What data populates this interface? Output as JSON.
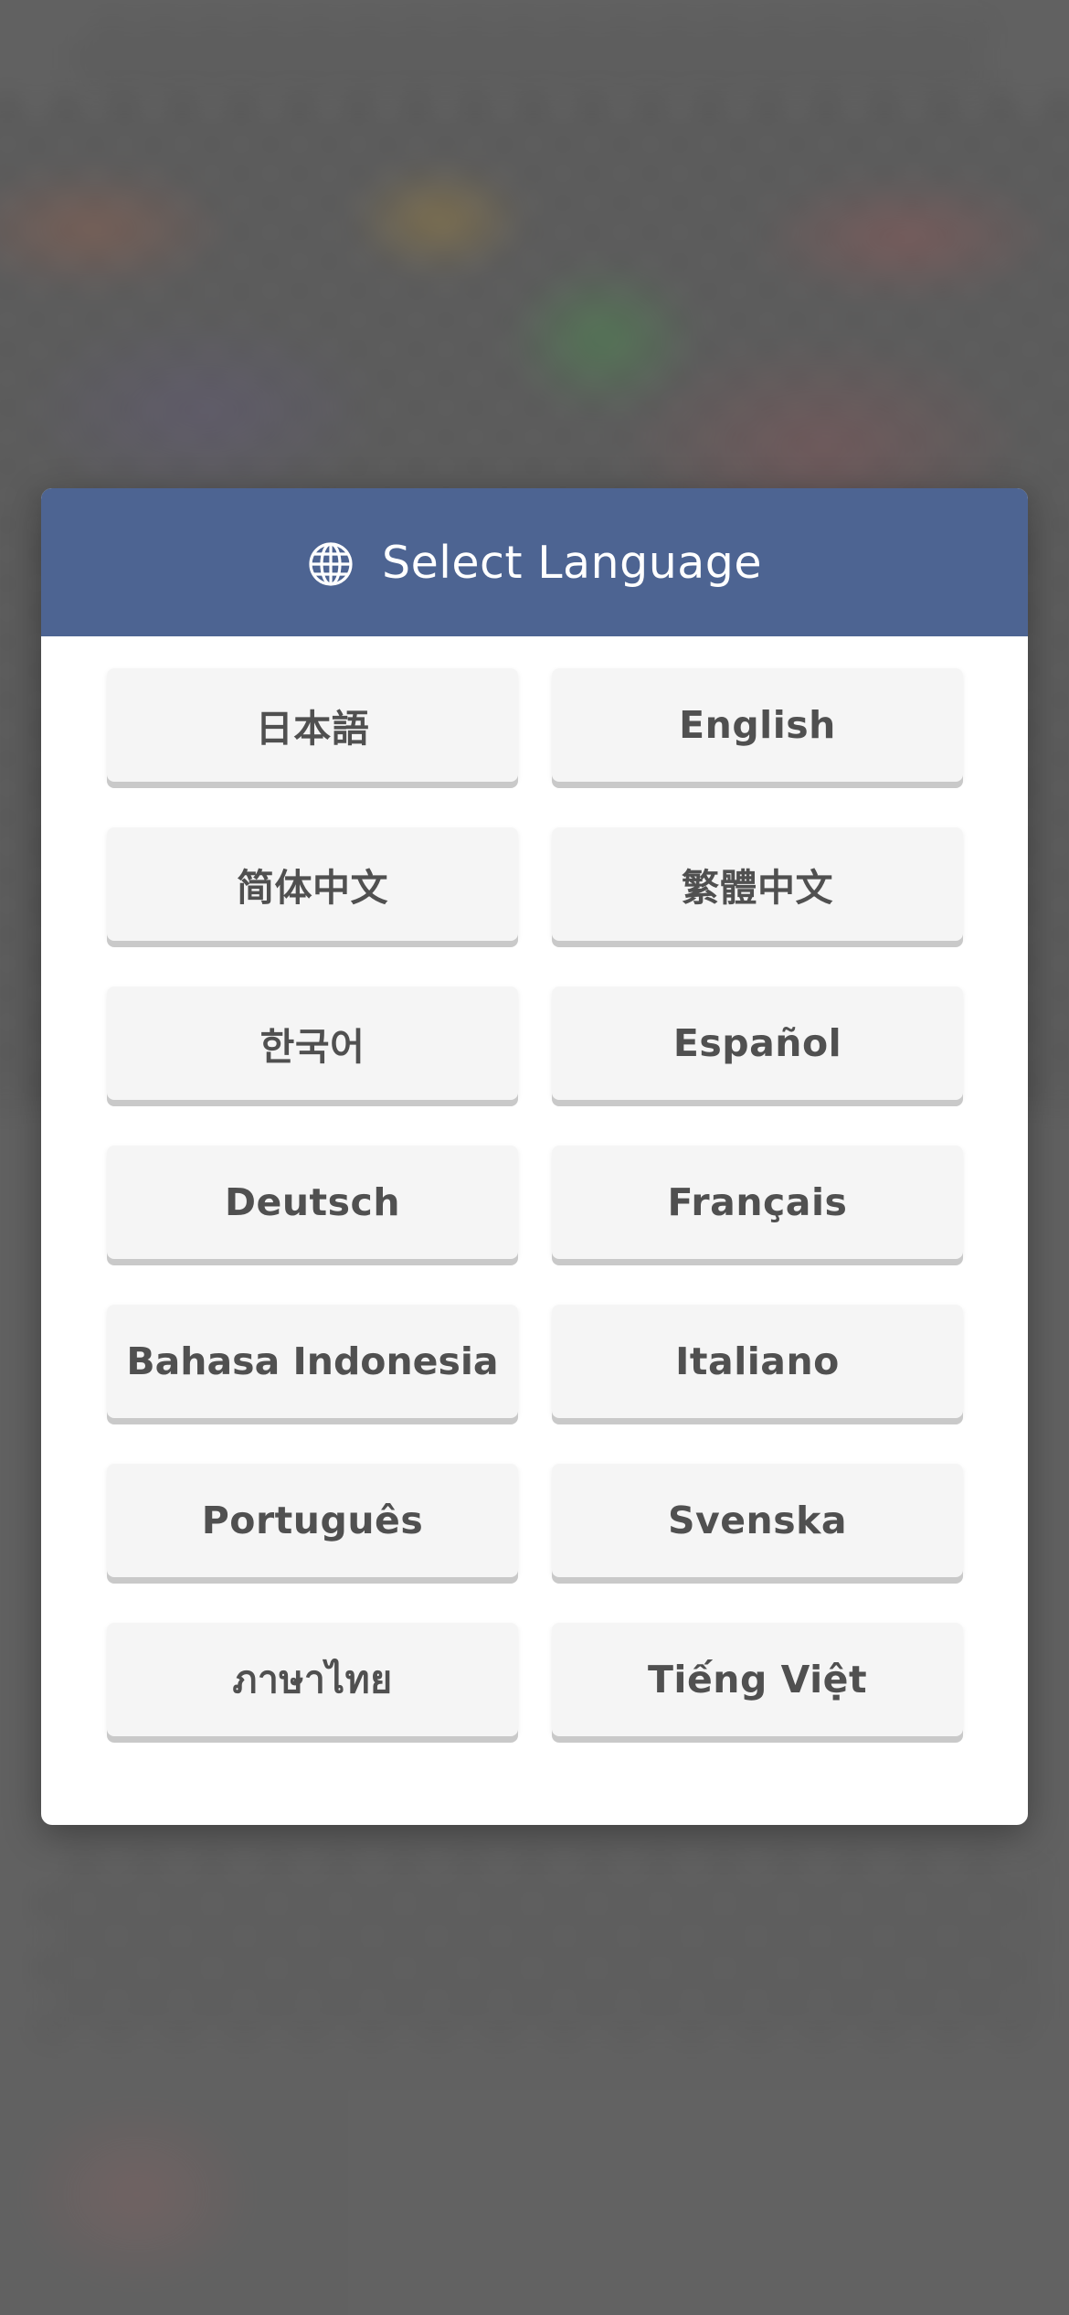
{
  "dialog": {
    "title": "Select Language",
    "icon": "globe-icon",
    "header_color": "#4d6492"
  },
  "languages": [
    {
      "label": "日本語"
    },
    {
      "label": "English"
    },
    {
      "label": "简体中文"
    },
    {
      "label": "繁體中文"
    },
    {
      "label": "한국어"
    },
    {
      "label": "Español"
    },
    {
      "label": "Deutsch"
    },
    {
      "label": "Français"
    },
    {
      "label": "Bahasa Indonesia"
    },
    {
      "label": "Italiano"
    },
    {
      "label": "Português"
    },
    {
      "label": "Svenska"
    },
    {
      "label": "ภาษาไทย"
    },
    {
      "label": "Tiếng Việt"
    }
  ]
}
